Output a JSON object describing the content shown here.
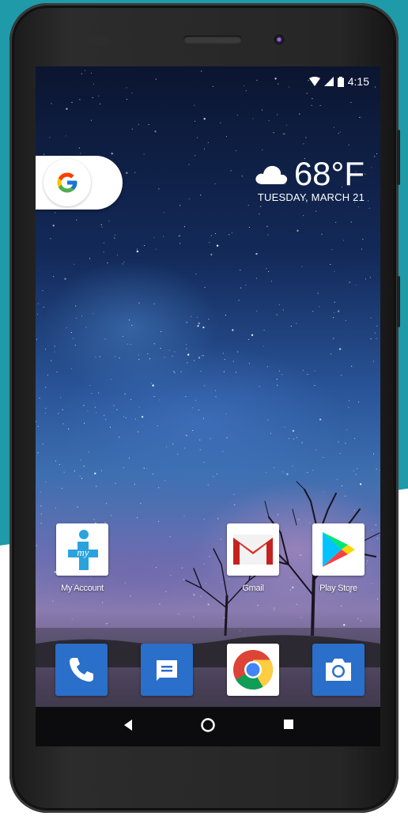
{
  "status_bar": {
    "time": "4:15"
  },
  "weather": {
    "temperature": "68°F",
    "date": "TUESDAY, MARCH 21"
  },
  "home_apps": [
    {
      "label": "My Account",
      "icon": "my-account-icon"
    },
    {
      "label": "Gmail",
      "icon": "gmail-icon"
    },
    {
      "label": "Play Store",
      "icon": "play-store-icon"
    }
  ],
  "dock_apps": [
    {
      "name": "Phone",
      "icon": "phone-icon"
    },
    {
      "name": "Messages",
      "icon": "messages-icon"
    },
    {
      "name": "Chrome",
      "icon": "chrome-icon"
    },
    {
      "name": "Camera",
      "icon": "camera-icon"
    }
  ],
  "colors": {
    "teal_background": "#1e9aa8",
    "dock_blue": "#2a6fc9",
    "google_blue": "#4285f4"
  },
  "my_account_logo_text": "my"
}
